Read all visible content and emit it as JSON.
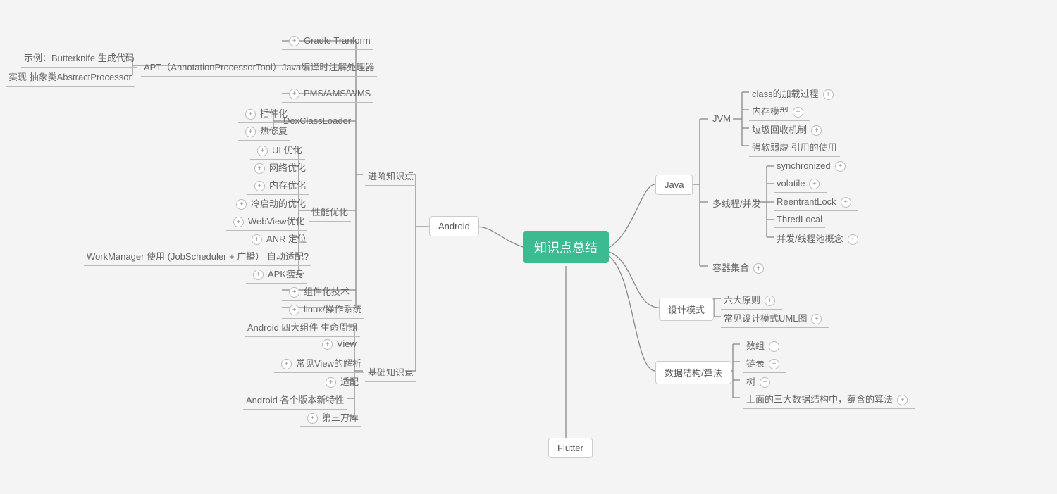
{
  "root": {
    "label": "知识点总结"
  },
  "mainBranches": {
    "android": "Android",
    "flutter": "Flutter",
    "java": "Java",
    "designPattern": "设计模式",
    "dataAlgo": "数据结构/算法"
  },
  "android": {
    "advanced": {
      "label": "进阶知识点",
      "gradle": "Gradle Tranform",
      "apt": {
        "label": "APT（AnnotationProcessorTool）Java编译时注解处理器",
        "ex1": "示例：Butterknife 生成代码",
        "ex2": "实现 抽象类AbstractProcessor"
      },
      "pms": "PMS/AMS/WMS",
      "dex": {
        "label": "DexClassLoader",
        "plugin": "插件化",
        "hotfix": "热修复"
      },
      "perf": {
        "label": "性能优化",
        "ui": "UI 优化",
        "net": "网络优化",
        "mem": "内存优化",
        "cold": "冷启动的优化",
        "webview": "WebView优化",
        "anr": "ANR 定位",
        "wm": "WorkManager 使用 (JobScheduler  + 广播） 自动适配?",
        "apk": "APK瘦身"
      },
      "componentize": "组件化技术",
      "linux": "linux/操作系统"
    },
    "basic": {
      "label": "基础知识点",
      "fourComp": "Android 四大组件 生命周期",
      "view": "View",
      "viewParse": "常见View的解析",
      "adapt": "适配",
      "versions": "Android  各个版本新特性",
      "thirdparty": "第三方库"
    }
  },
  "java": {
    "jvm": {
      "label": "JVM",
      "classload": "class的加载过程",
      "memmodel": "内存模型",
      "gc": "垃圾回收机制",
      "ref": "强软弱虚 引用的使用"
    },
    "concurrent": {
      "label": "多线程/并发",
      "sync": "synchronized",
      "volatile": "volatile",
      "reentrant": "ReentrantLock",
      "threadlocal": "ThredLocal",
      "pool": "并发/线程池概念"
    },
    "collection": "容器集合"
  },
  "design": {
    "six": "六大原则",
    "uml": "常见设计模式UML图"
  },
  "dataAlgo": {
    "array": "数组",
    "linked": "链表",
    "tree": "树",
    "algo": "上面的三大数据结构中，蕴含的算法"
  }
}
